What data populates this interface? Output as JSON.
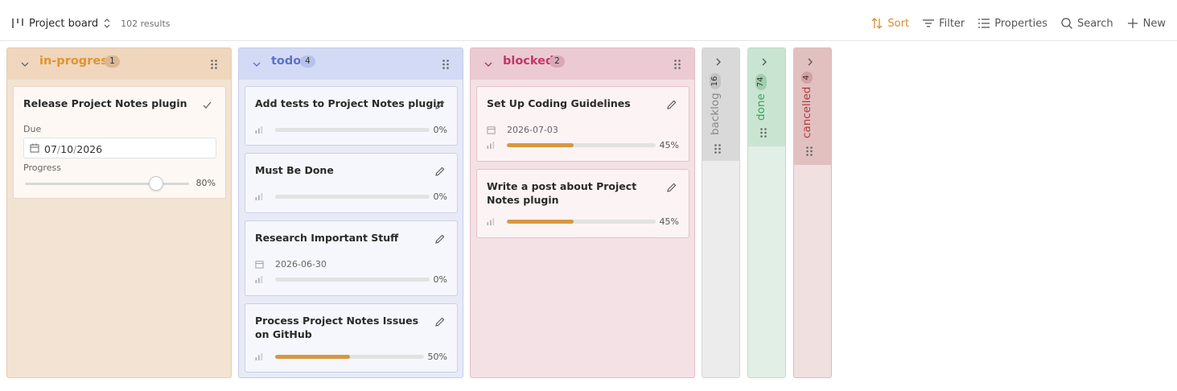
{
  "toolbar": {
    "view_name": "Project board",
    "results": "102 results",
    "sort": "Sort",
    "filter": "Filter",
    "properties": "Properties",
    "search": "Search",
    "new": "New"
  },
  "colors": {
    "accent": "#d78e33",
    "progress_fill": "#d79840",
    "in_progress": "#e3922f",
    "todo": "#5b72c9",
    "blocked": "#c1366a",
    "backlog": "#8a8a8a",
    "done": "#3aa55c",
    "cancelled": "#b23a3a"
  },
  "columns": {
    "in_progress": {
      "title": "in-progress",
      "count": "1",
      "cards": [
        {
          "title": "Release Project Notes plugin",
          "due_label": "Due",
          "due_month": "07",
          "due_day": "10",
          "due_year": "2026",
          "progress_label": "Progress",
          "progress": 80,
          "progress_text": "80%"
        }
      ]
    },
    "todo": {
      "title": "todo",
      "count": "4",
      "cards": [
        {
          "title": "Add tests to Project Notes plugin",
          "progress": 0,
          "progress_text": "0%"
        },
        {
          "title": "Must Be Done",
          "progress": 0,
          "progress_text": "0%"
        },
        {
          "title": "Research Important Stuff",
          "date": "2026-06-30",
          "progress": 0,
          "progress_text": "0%"
        },
        {
          "title": "Process Project Notes Issues on GitHub",
          "progress": 50,
          "progress_text": "50%"
        }
      ]
    },
    "blocked": {
      "title": "blocked",
      "count": "2",
      "cards": [
        {
          "title": "Set Up Coding Guidelines",
          "date": "2026-07-03",
          "progress": 45,
          "progress_text": "45%"
        },
        {
          "title": "Write a post about Project Notes plugin",
          "progress": 45,
          "progress_text": "45%"
        }
      ]
    },
    "backlog": {
      "title": "backlog",
      "count": "16"
    },
    "done": {
      "title": "done",
      "count": "74"
    },
    "cancelled": {
      "title": "cancelled",
      "count": "4"
    }
  }
}
